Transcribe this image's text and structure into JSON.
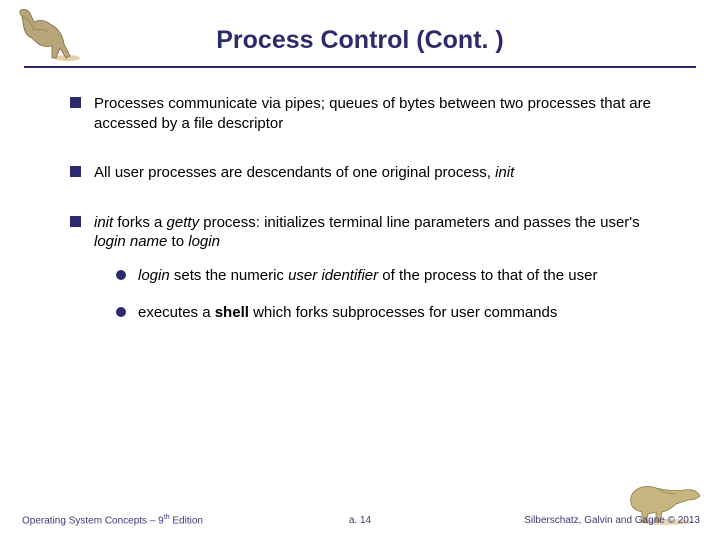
{
  "title": "Process Control (Cont. )",
  "bullets": {
    "b1": {
      "text": "Processes communicate via pipes; queues of bytes between two processes that are accessed by a file descriptor"
    },
    "b2": {
      "pre": "All user processes are descendants of one original process, ",
      "init": "init"
    },
    "b3": {
      "init": "init",
      "mid1": " forks a ",
      "getty": "getty",
      "mid2": " process: initializes terminal line parameters and passes the user's ",
      "loginname": "login name",
      "mid3": " to ",
      "login": "login"
    },
    "sub1": {
      "login": "login",
      "mid1": " sets the numeric ",
      "uid": "user identifier",
      "mid2": " of the process to that of the user"
    },
    "sub2": {
      "pre": "executes a ",
      "shell": "shell",
      "post": " which forks subprocesses for user commands"
    }
  },
  "footer": {
    "left_pre": "Operating System Concepts – 9",
    "left_sup": "th",
    "left_post": " Edition",
    "center": "a. 14",
    "right": "Silberschatz, Galvin and Gagne © 2013"
  }
}
